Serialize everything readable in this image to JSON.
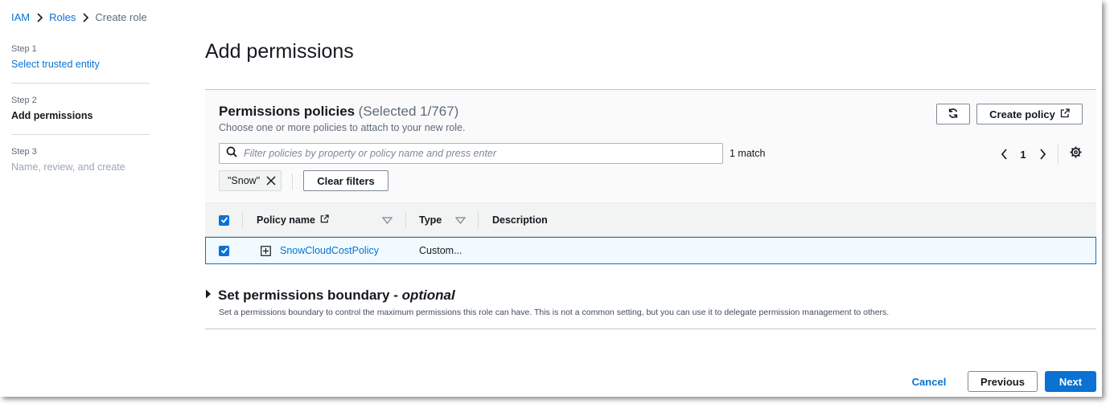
{
  "breadcrumb": {
    "items": [
      "IAM",
      "Roles"
    ],
    "current": "Create role"
  },
  "steps": [
    {
      "number": "Step 1",
      "label": "Select trusted entity",
      "state": "link"
    },
    {
      "number": "Step 2",
      "label": "Add permissions",
      "state": "active"
    },
    {
      "number": "Step 3",
      "label": "Name, review, and create",
      "state": "disabled"
    }
  ],
  "page": {
    "title": "Add permissions"
  },
  "policies": {
    "title": "Permissions policies",
    "count": "(Selected 1/767)",
    "description": "Choose one or more policies to attach to your new role.",
    "create_policy_label": "Create policy",
    "search_placeholder": "Filter policies by property or policy name and press enter",
    "match_count": "1 match",
    "page_number": "1",
    "filter_token": "\"Snow\"",
    "clear_filters_label": "Clear filters",
    "columns": [
      "Policy name",
      "Type",
      "Description"
    ],
    "rows": [
      {
        "name": "SnowCloudCostPolicy",
        "type": "Custom...",
        "description": "",
        "selected": true
      }
    ]
  },
  "boundary": {
    "title": "Set permissions boundary - ",
    "title_optional": "optional",
    "description": "Set a permissions boundary to control the maximum permissions this role can have. This is not a common setting, but you can use it to delegate permission management to others."
  },
  "footer": {
    "cancel_label": "Cancel",
    "previous_label": "Previous",
    "next_label": "Next"
  },
  "colors": {
    "accent": "#0972d3",
    "selected_row_bg": "#f1faff"
  }
}
